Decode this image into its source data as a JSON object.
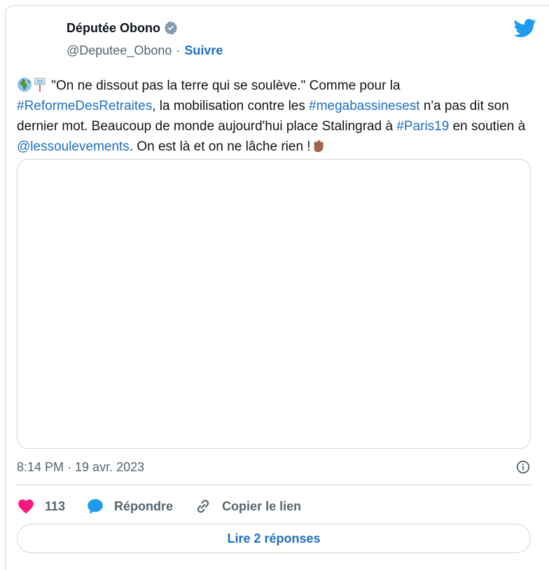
{
  "author": {
    "display_name": "Députée Obono",
    "handle": "@Deputee_Obono",
    "separator": "·",
    "follow_label": "Suivre"
  },
  "tweet": {
    "segments": [
      {
        "type": "text",
        "text": "\"On ne dissout pas la terre qui se soulève.\" Comme pour la "
      },
      {
        "type": "link",
        "text": "#ReformeDesRetraites"
      },
      {
        "type": "text",
        "text": ", la mobilisation contre les "
      },
      {
        "type": "link",
        "text": "#megabassinesest"
      },
      {
        "type": "text",
        "text": " n'a pas dit son dernier mot. Beaucoup de monde aujourd'hui place Stalingrad à "
      },
      {
        "type": "link",
        "text": "#Paris19"
      },
      {
        "type": "text",
        "text": " en soutien à "
      },
      {
        "type": "link",
        "text": "@lessoulevements"
      },
      {
        "type": "text",
        "text": ". On est là et on ne lâche rien !"
      }
    ],
    "leading_emojis": [
      "globe-africa-icon",
      "placard-icon"
    ],
    "trailing_emoji": "raised-fist-icon"
  },
  "meta": {
    "timestamp": "8:14 PM · 19 avr. 2023"
  },
  "actions": {
    "like_count": "113",
    "reply_label": "Répondre",
    "copy_link_label": "Copier le lien"
  },
  "footer": {
    "read_replies_label": "Lire 2 réponses"
  },
  "colors": {
    "link": "#1d6fc2",
    "like": "#f91880",
    "reply_bubble": "#1d9bf0",
    "muted": "#536471",
    "border": "#cfd9de",
    "twitter_blue": "#1d9bf0"
  }
}
